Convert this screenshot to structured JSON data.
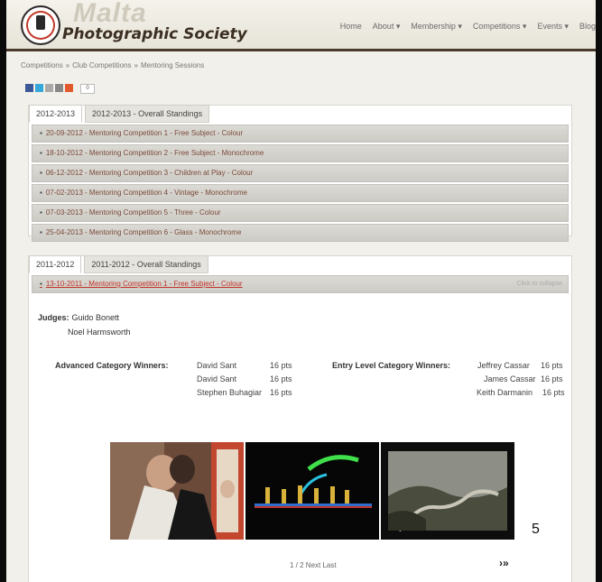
{
  "header": {
    "logo_top": "Malta",
    "logo_bottom": "Photographic Society",
    "nav": [
      "Home",
      "About ▾",
      "Membership ▾",
      "Competitions ▾",
      "Events ▾",
      "Blog"
    ]
  },
  "breadcrumb": [
    "Competitions",
    "Club Competitions",
    "Mentoring Sessions"
  ],
  "breadcrumb_sep": "»",
  "share_count": "0",
  "season1": {
    "tabs": [
      "2012-2013",
      "2012-2013 - Overall Standings"
    ],
    "rows": [
      "20-09-2012 - Mentoring Competition 1 - Free Subject - Colour",
      "18-10-2012 - Mentoring Competition 2 - Free Subject - Monochrome",
      "06-12-2012 - Mentoring Competition 3 - Children at Play - Colour",
      "07-02-2013 - Mentoring Competition 4 - Vintage - Monochrome",
      "07-03-2013 - Mentoring Competition 5 - Three - Colour",
      "25-04-2013 - Mentoring Competition 6 - Glass - Monochrome"
    ]
  },
  "season2": {
    "tabs": [
      "2011-2012",
      "2011-2012 - Overall Standings"
    ],
    "open_row": "13-10-2011 - Mentoring Competition 1 - Free Subject - Colour",
    "collapse_label": "Click to collapse",
    "judges_label": "Judges:",
    "judges": [
      "Guido Bonett",
      "Noel Harmsworth"
    ],
    "advanced_title": "Advanced Category Winners:",
    "advanced": [
      {
        "name": "David Sant",
        "pts": "16 pts"
      },
      {
        "name": "David Sant",
        "pts": "16 pts"
      },
      {
        "name": "Stephen Buhagiar",
        "pts": "16 pts"
      }
    ],
    "entry_title": "Entry Level Category Winners:",
    "entry": [
      {
        "name": "Jeffrey Cassar",
        "pts": "16 pts"
      },
      {
        "name": "James Cassar",
        "pts": "16 pts"
      },
      {
        "name": "Keith Darmanin",
        "pts": "16 pts"
      }
    ],
    "pager": "1 / 2 Next Last",
    "next_symbol": "›»"
  },
  "page_number": "5"
}
